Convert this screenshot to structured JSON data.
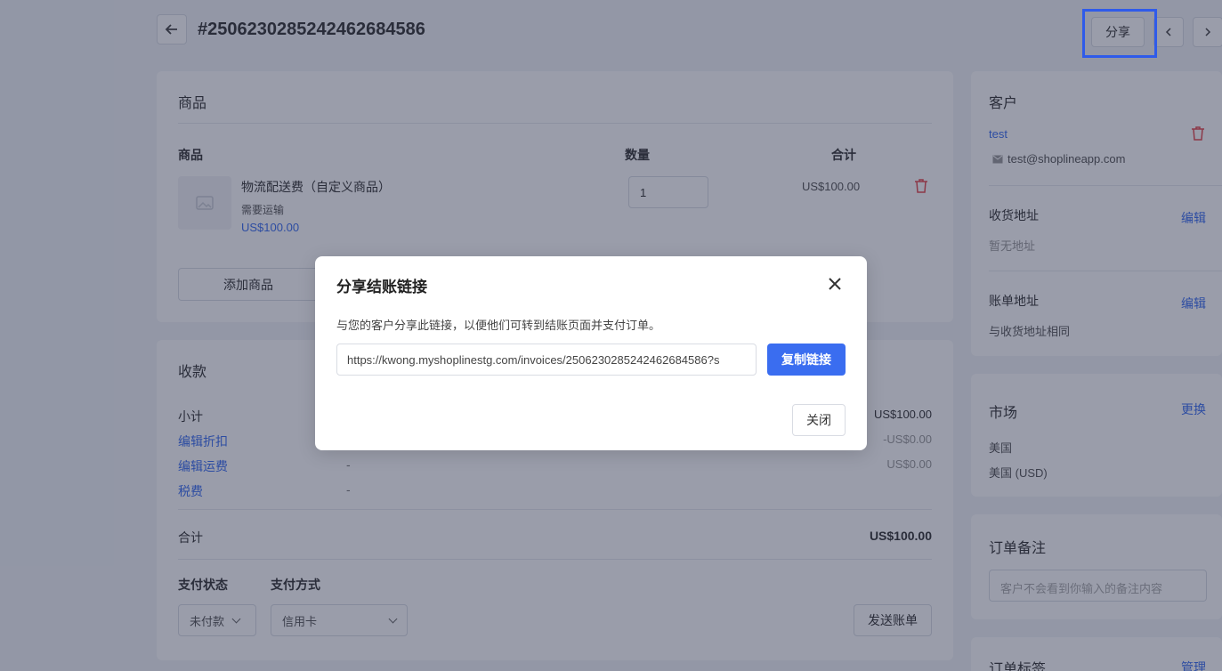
{
  "header": {
    "order_number": "#25062302852424626845­86",
    "share_label": "分享"
  },
  "products": {
    "title": "商品",
    "col_product": "商品",
    "col_quantity": "数量",
    "col_total": "合计",
    "item": {
      "name": "物流配送费（自定义商品）",
      "shipping": "需要运输",
      "price": "US$100.00",
      "quantity": "1",
      "total": "US$100.00"
    },
    "add_button": "添加商品"
  },
  "payment": {
    "title": "收款",
    "subtotal_label": "小计",
    "subtotal_value": "US$100.00",
    "discount_label": "编辑折扣",
    "discount_value": "-US$0.00",
    "shipping_label": "编辑运费",
    "shipping_dash": "-",
    "shipping_value": "US$0.00",
    "tax_label": "税费",
    "tax_dash": "-",
    "total_label": "合计",
    "total_value": "US$100.00",
    "status_label": "支付状态",
    "method_label": "支付方式",
    "status_value": "未付款",
    "method_value": "信用卡",
    "send_invoice": "发送账单"
  },
  "customer": {
    "title": "客户",
    "name": "test",
    "email": "test@shoplineapp.com",
    "shipping_title": "收货地址",
    "shipping_edit": "编辑",
    "shipping_value": "暂无地址",
    "billing_title": "账单地址",
    "billing_edit": "编辑",
    "billing_value": "与收货地址相同"
  },
  "market": {
    "title": "市场",
    "change": "更换",
    "country": "美国",
    "currency": "美国 (USD)"
  },
  "notes": {
    "title": "订单备注",
    "placeholder": "客户不会看到你输入的备注内容"
  },
  "tags": {
    "title": "订单标签",
    "manage": "管理"
  },
  "modal": {
    "title": "分享结账链接",
    "description": "与您的客户分享此链接，以便他们可转到结账页面并支付订单。",
    "link": "https://kwong.myshoplinestg.com/invoices/25062302852424626845­86?s",
    "copy_button": "复制链接",
    "close_button": "关闭"
  },
  "colors": {
    "accent": "#3a6df0",
    "danger": "#e5484d",
    "highlight": "#2f5bea"
  }
}
